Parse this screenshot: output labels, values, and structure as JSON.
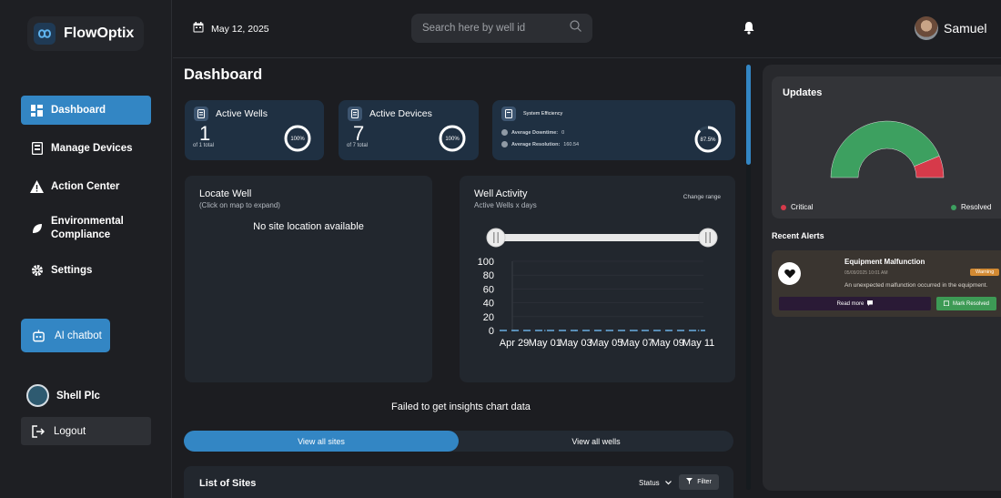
{
  "app": {
    "name": "FlowOptix"
  },
  "sidebar": {
    "items": [
      {
        "label": "Dashboard",
        "icon": "dashboard-icon",
        "active": true
      },
      {
        "label": "Manage Devices",
        "icon": "device-icon"
      },
      {
        "label": "Action Center",
        "icon": "warning-icon"
      },
      {
        "label": "Environmental Compliance",
        "icon": "leaf-icon"
      },
      {
        "label": "Settings",
        "icon": "gear-icon"
      }
    ],
    "chatbot": "AI chatbot",
    "org": "Shell Plc",
    "logout": "Logout"
  },
  "topbar": {
    "date": "May 12, 2025",
    "search_placeholder": "Search here by well id",
    "user": "Samuel"
  },
  "main": {
    "title": "Dashboard",
    "stats": [
      {
        "label": "Active Wells",
        "value": "1",
        "sub": "of 1 total",
        "ring": "100%",
        "fraction": 1.0
      },
      {
        "label": "Active Devices",
        "value": "7",
        "sub": "of 7 total",
        "ring": "100%",
        "fraction": 1.0
      }
    ],
    "efficiency": {
      "label": "System Efficiency",
      "downtime_label": "Average Downtime:",
      "downtime_value": "0",
      "resolution_label": "Average Resolution:",
      "resolution_value": "160.54",
      "ring": "87.5%",
      "fraction": 0.875
    },
    "locate": {
      "title": "Locate Well",
      "sub": "(Click on map to expand)",
      "empty": "No site location available"
    },
    "activity": {
      "title": "Well Activity",
      "sub": "Active Wells x days",
      "change_range": "Change range"
    },
    "failed": "Failed to get insights chart data",
    "toggle": {
      "sites": "View all sites",
      "wells": "View all wells"
    },
    "list": {
      "title": "List of Sites",
      "status": "Status",
      "filter": "Filter"
    }
  },
  "chart_data": {
    "type": "line",
    "x": [
      "Apr 29",
      "May 01",
      "May 03",
      "May 05",
      "May 07",
      "May 09",
      "May 11"
    ],
    "series": [
      {
        "values": [
          0,
          0,
          0,
          0,
          0,
          0,
          0
        ]
      }
    ],
    "y_ticks": [
      "100",
      "80",
      "60",
      "40",
      "20",
      "0"
    ],
    "ylim": [
      0,
      100
    ]
  },
  "updates": {
    "title": "Updates",
    "gauge": {
      "resolved_fraction": 0.875,
      "critical_fraction": 0.125
    },
    "legend_critical": "Critical",
    "legend_resolved": "Resolved",
    "colors": {
      "critical": "#d63a4a",
      "resolved": "#3da060",
      "accent": "#3386c4"
    }
  },
  "alerts": {
    "title": "Recent Alerts",
    "items": [
      {
        "title": "Equipment Malfunction",
        "time": "05/09/2025 10:01 AM",
        "badge": "Warning",
        "message": "An unexpected malfunction occurred in the equipment.",
        "read_more": "Read more",
        "resolve": "Mark Resolved"
      }
    ]
  }
}
